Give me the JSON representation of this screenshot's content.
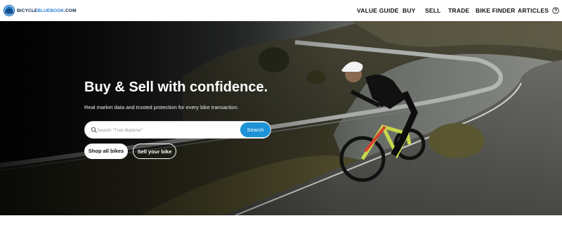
{
  "brand": {
    "logo_text_1": "BICYCLE",
    "logo_text_2": "BLUEBOOK",
    "logo_text_3": ".COM",
    "logo_icon": "bicycle-wheel-logo-icon"
  },
  "nav": {
    "items": [
      {
        "label": "VALUE GUIDE"
      },
      {
        "label": "BUY"
      },
      {
        "label": "SELL"
      },
      {
        "label": "TRADE"
      },
      {
        "label": "BIKE FINDER"
      },
      {
        "label": "ARTICLES"
      }
    ],
    "help_icon": "help-circle-icon"
  },
  "hero": {
    "headline": "Buy & Sell with confidence.",
    "subline": "Real market data and trusted protection for every bike transaction.",
    "search": {
      "placeholder": "Search \"Trek Madone\"",
      "value": "",
      "button_label": "Search",
      "icon": "search-icon"
    },
    "buttons": {
      "shop_label": "Shop all bikes",
      "sell_label": "Sell your bike"
    }
  },
  "colors": {
    "accent": "#1d92d6",
    "brand_dark": "#0c2a4d",
    "brand_blue": "#2a7fd4"
  }
}
